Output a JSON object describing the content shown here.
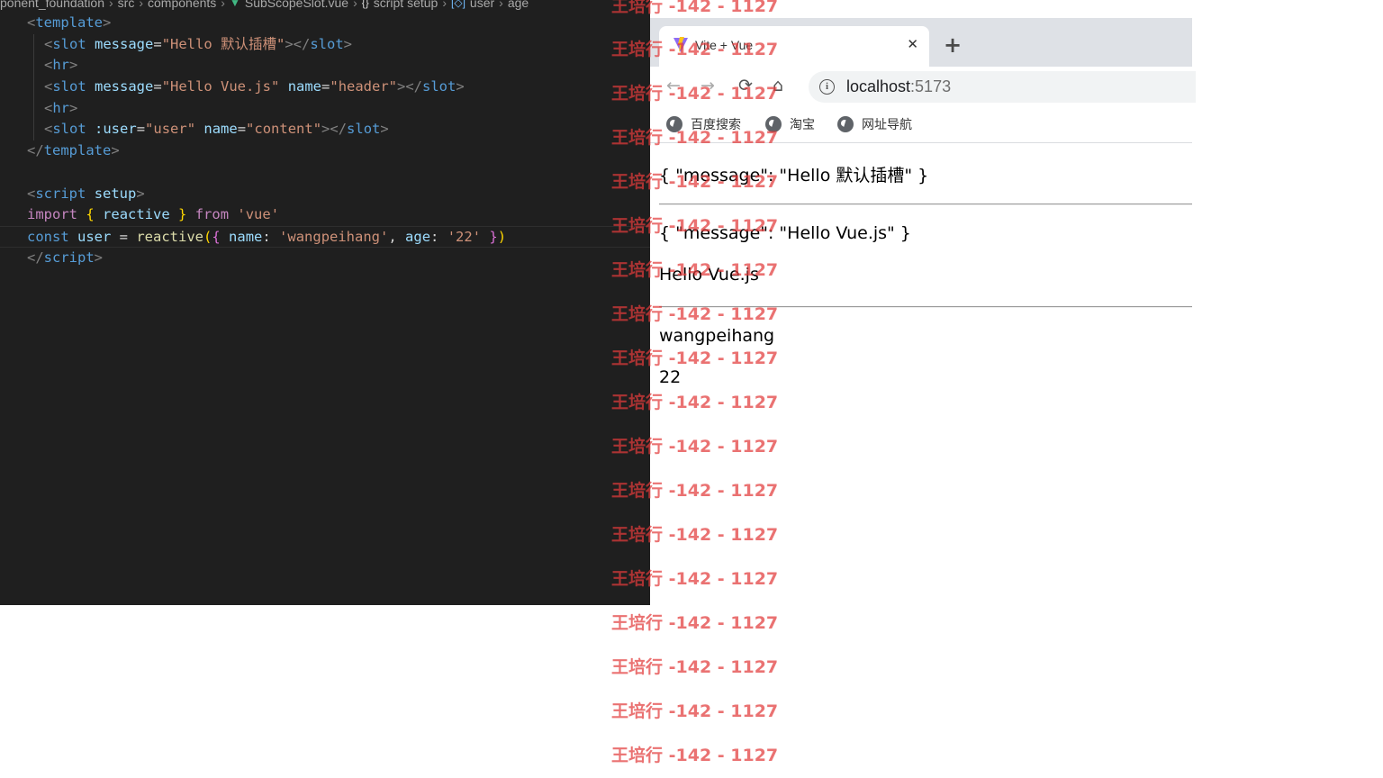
{
  "editor": {
    "breadcrumb": [
      "ponent_foundation",
      "src",
      "components",
      "SubScopeSlot.vue",
      "script setup",
      "user",
      "age"
    ],
    "lines": [
      [
        [
          "tag-bracket",
          "<"
        ],
        [
          "tag",
          "template"
        ],
        [
          "tag-bracket",
          ">"
        ]
      ],
      [
        [
          "tag-bracket",
          "<"
        ],
        [
          "tag",
          "slot"
        ],
        [
          "plain",
          " "
        ],
        [
          "attr",
          "message"
        ],
        [
          "eq",
          "="
        ],
        [
          "str",
          "\"Hello 默认插槽\""
        ],
        [
          "tag-bracket",
          "></"
        ],
        [
          "tag",
          "slot"
        ],
        [
          "tag-bracket",
          ">"
        ]
      ],
      [
        [
          "tag-bracket",
          "<"
        ],
        [
          "tag",
          "hr"
        ],
        [
          "tag-bracket",
          ">"
        ]
      ],
      [
        [
          "tag-bracket",
          "<"
        ],
        [
          "tag",
          "slot"
        ],
        [
          "plain",
          " "
        ],
        [
          "attr",
          "message"
        ],
        [
          "eq",
          "="
        ],
        [
          "str",
          "\"Hello Vue.js\""
        ],
        [
          "plain",
          " "
        ],
        [
          "attr",
          "name"
        ],
        [
          "eq",
          "="
        ],
        [
          "str",
          "\"header\""
        ],
        [
          "tag-bracket",
          "></"
        ],
        [
          "tag",
          "slot"
        ],
        [
          "tag-bracket",
          ">"
        ]
      ],
      [
        [
          "tag-bracket",
          "<"
        ],
        [
          "tag",
          "hr"
        ],
        [
          "tag-bracket",
          ">"
        ]
      ],
      [
        [
          "tag-bracket",
          "<"
        ],
        [
          "tag",
          "slot"
        ],
        [
          "plain",
          " "
        ],
        [
          "attr",
          ":user"
        ],
        [
          "eq",
          "="
        ],
        [
          "str",
          "\"user\""
        ],
        [
          "plain",
          " "
        ],
        [
          "attr",
          "name"
        ],
        [
          "eq",
          "="
        ],
        [
          "str",
          "\"content\""
        ],
        [
          "tag-bracket",
          "></"
        ],
        [
          "tag",
          "slot"
        ],
        [
          "tag-bracket",
          ">"
        ]
      ],
      [
        [
          "tag-bracket",
          "</"
        ],
        [
          "tag",
          "template"
        ],
        [
          "tag-bracket",
          ">"
        ]
      ],
      [],
      [
        [
          "tag-bracket",
          "<"
        ],
        [
          "tag",
          "script"
        ],
        [
          "plain",
          " "
        ],
        [
          "attr",
          "setup"
        ],
        [
          "tag-bracket",
          ">"
        ]
      ],
      [
        [
          "kw-import",
          "import"
        ],
        [
          "plain",
          " "
        ],
        [
          "brace-y",
          "{"
        ],
        [
          "plain",
          " "
        ],
        [
          "ident",
          "reactive"
        ],
        [
          "plain",
          " "
        ],
        [
          "brace-y",
          "}"
        ],
        [
          "plain",
          " "
        ],
        [
          "kw-import",
          "from"
        ],
        [
          "plain",
          " "
        ],
        [
          "str",
          "'vue'"
        ]
      ],
      [
        [
          "kw-const",
          "const"
        ],
        [
          "plain",
          " "
        ],
        [
          "ident",
          "user"
        ],
        [
          "plain",
          " = "
        ],
        [
          "fn",
          "reactive"
        ],
        [
          "brace-y",
          "("
        ],
        [
          "brace-p",
          "{"
        ],
        [
          "plain",
          " "
        ],
        [
          "ident",
          "name"
        ],
        [
          "plain",
          ": "
        ],
        [
          "str",
          "'wangpeihang'"
        ],
        [
          "plain",
          ", "
        ],
        [
          "ident",
          "age"
        ],
        [
          "plain",
          ": "
        ],
        [
          "str",
          "'22'"
        ],
        [
          "plain",
          " "
        ],
        [
          "brace-p",
          "}"
        ],
        [
          "brace-y",
          ")"
        ]
      ],
      [
        [
          "tag-bracket",
          "</"
        ],
        [
          "tag",
          "script"
        ],
        [
          "tag-bracket",
          ">"
        ]
      ]
    ]
  },
  "browser": {
    "tab_title": "Vite + Vue",
    "close_glyph": "✕",
    "new_tab_glyph": "+",
    "back_glyph": "←",
    "forward_glyph": "→",
    "reload_glyph": "⟳",
    "home_glyph": "⌂",
    "info_glyph": "i",
    "url_host": "localhost",
    "url_port": ":5173",
    "bookmarks": [
      "百度搜索",
      "淘宝",
      "网址导航"
    ],
    "page": {
      "line1": "{ \"message\": \"Hello 默认插槽\" }",
      "line2": "{ \"message\": \"Hello Vue.js\" }",
      "line3": "Hello Vue.js",
      "line4": "wangpeihang",
      "line5": "22"
    }
  },
  "watermark": {
    "text": "王培行 -142 - 1127",
    "top_text": "王培行 -142 - 1127"
  },
  "icons": {
    "vite_favicon": "vite-favicon-icon",
    "globe": "globe-icon"
  }
}
